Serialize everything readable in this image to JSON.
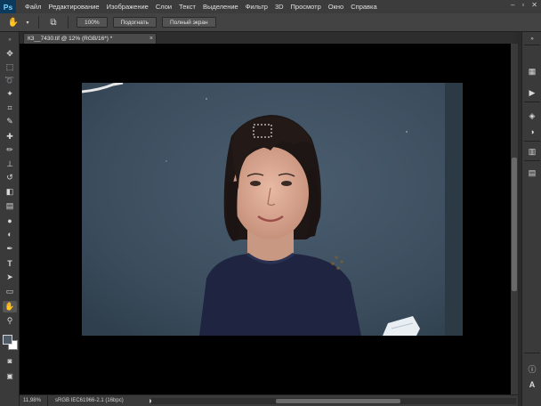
{
  "app": {
    "logo": "Ps"
  },
  "menu": [
    "Файл",
    "Редактирование",
    "Изображение",
    "Слои",
    "Текст",
    "Выделение",
    "Фильтр",
    "3D",
    "Просмотр",
    "Окно",
    "Справка"
  ],
  "window_controls": {
    "minimize": "–",
    "restore": "▫",
    "close": "✕"
  },
  "options": {
    "zoom_100": "100%",
    "fit_screen": "Подогнать",
    "full_screen": "Полный экран"
  },
  "document": {
    "tab_title": "К3__7430.tif @ 12% (RGB/16*) *",
    "close": "×"
  },
  "status": {
    "zoom": "11,98%",
    "profile": "sRGB IEC61966-2.1 (16bpc)",
    "arrow": "▶"
  },
  "tools": [
    {
      "icon": "move-icon",
      "glyph": "✥"
    },
    {
      "icon": "marquee-icon",
      "glyph": "⬚"
    },
    {
      "icon": "lasso-icon",
      "glyph": "➰"
    },
    {
      "icon": "magic-wand-icon",
      "glyph": "✦"
    },
    {
      "icon": "crop-icon",
      "glyph": "⌗"
    },
    {
      "icon": "eyedropper-icon",
      "glyph": "✎"
    },
    {
      "icon": "healing-brush-icon",
      "glyph": "✚"
    },
    {
      "icon": "brush-icon",
      "glyph": "✏"
    },
    {
      "icon": "clone-stamp-icon",
      "glyph": "⊥"
    },
    {
      "icon": "history-brush-icon",
      "glyph": "↺"
    },
    {
      "icon": "eraser-icon",
      "glyph": "◧"
    },
    {
      "icon": "gradient-icon",
      "glyph": "▤"
    },
    {
      "icon": "blur-icon",
      "glyph": "●"
    },
    {
      "icon": "dodge-icon",
      "glyph": "◐"
    },
    {
      "icon": "pen-icon",
      "glyph": "✒"
    },
    {
      "icon": "type-icon",
      "glyph": "T"
    },
    {
      "icon": "path-selection-icon",
      "glyph": "➤"
    },
    {
      "icon": "rectangle-icon",
      "glyph": "▭"
    },
    {
      "icon": "hand-icon",
      "glyph": "✋"
    },
    {
      "icon": "zoom-icon",
      "glyph": "⚲"
    }
  ],
  "dock_icons": [
    {
      "icon": "collapse-icon",
      "glyph": "»"
    },
    {
      "icon": "history-panel-icon",
      "glyph": "▦"
    },
    {
      "icon": "actions-panel-icon",
      "glyph": "▶"
    },
    {
      "icon": "layers-panel-icon",
      "glyph": "◈"
    },
    {
      "icon": "adjustments-panel-icon",
      "glyph": "◑"
    },
    {
      "icon": "histogram-panel-icon",
      "glyph": "▥"
    },
    {
      "icon": "color-panel-icon",
      "glyph": "✿"
    },
    {
      "icon": "swatches-panel-icon",
      "glyph": "▤"
    },
    {
      "icon": "info-panel-icon",
      "glyph": "ⓘ"
    },
    {
      "icon": "character-panel-icon",
      "glyph": "A"
    }
  ],
  "colors": {
    "foreground": "#4f5c68",
    "background": "#ffffff",
    "backdrop": "#3d4e5d"
  }
}
